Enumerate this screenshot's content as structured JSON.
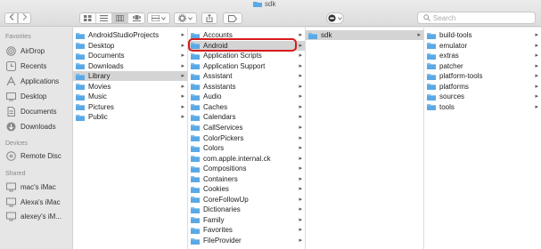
{
  "window": {
    "title": "sdk"
  },
  "toolbar": {
    "back_icon": "chevron-left",
    "forward_icon": "chevron-right",
    "view_modes": [
      "icon-view",
      "list-view",
      "column-view",
      "cover-flow-view"
    ],
    "search": {
      "placeholder": "Search",
      "value": ""
    }
  },
  "sidebar": {
    "favorites_header": "Favorites",
    "favorites": [
      {
        "label": "AirDrop",
        "icon": "airdrop-icon"
      },
      {
        "label": "Recents",
        "icon": "clock-icon"
      },
      {
        "label": "Applications",
        "icon": "applications-icon"
      },
      {
        "label": "Desktop",
        "icon": "desktop-icon"
      },
      {
        "label": "Documents",
        "icon": "documents-icon"
      },
      {
        "label": "Downloads",
        "icon": "downloads-icon"
      }
    ],
    "devices_header": "Devices",
    "devices": [
      {
        "label": "Remote Disc",
        "icon": "disc-icon"
      }
    ],
    "shared_header": "Shared",
    "shared": [
      {
        "label": "mac's iMac",
        "icon": "imac-icon"
      },
      {
        "label": "Alexa's iMac",
        "icon": "imac-icon"
      },
      {
        "label": "alexey's iM...",
        "icon": "imac-icon"
      }
    ]
  },
  "columns": {
    "home": [
      {
        "label": "AndroidStudioProjects",
        "chevron": true
      },
      {
        "label": "Desktop",
        "chevron": true
      },
      {
        "label": "Documents",
        "chevron": true
      },
      {
        "label": "Downloads",
        "chevron": true
      },
      {
        "label": "Library",
        "chevron": true,
        "selected": true
      },
      {
        "label": "Movies",
        "chevron": true
      },
      {
        "label": "Music",
        "chevron": true
      },
      {
        "label": "Pictures",
        "chevron": true
      },
      {
        "label": "Public",
        "chevron": true
      }
    ],
    "library": [
      {
        "label": "Accounts",
        "chevron": true
      },
      {
        "label": "Android",
        "chevron": true,
        "selected": true
      },
      {
        "label": "Application Scripts",
        "chevron": true
      },
      {
        "label": "Application Support",
        "chevron": true
      },
      {
        "label": "Assistant",
        "chevron": true
      },
      {
        "label": "Assistants",
        "chevron": true
      },
      {
        "label": "Audio",
        "chevron": true
      },
      {
        "label": "Caches",
        "chevron": true
      },
      {
        "label": "Calendars",
        "chevron": true
      },
      {
        "label": "CallServices",
        "chevron": true
      },
      {
        "label": "ColorPickers",
        "chevron": true
      },
      {
        "label": "Colors",
        "chevron": true
      },
      {
        "label": "com.apple.internal.ck",
        "chevron": true
      },
      {
        "label": "Compositions",
        "chevron": true
      },
      {
        "label": "Containers",
        "chevron": true
      },
      {
        "label": "Cookies",
        "chevron": true
      },
      {
        "label": "CoreFollowUp",
        "chevron": true
      },
      {
        "label": "Dictionaries",
        "chevron": true
      },
      {
        "label": "Family",
        "chevron": true
      },
      {
        "label": "Favorites",
        "chevron": true
      },
      {
        "label": "FileProvider",
        "chevron": true
      }
    ],
    "android": [
      {
        "label": "sdk",
        "chevron": true,
        "selected": true
      }
    ],
    "sdk": [
      {
        "label": "build-tools",
        "chevron": true
      },
      {
        "label": "emulator",
        "chevron": true
      },
      {
        "label": "extras",
        "chevron": true
      },
      {
        "label": "patcher",
        "chevron": true
      },
      {
        "label": "platform-tools",
        "chevron": true
      },
      {
        "label": "platforms",
        "chevron": true
      },
      {
        "label": "sources",
        "chevron": true
      },
      {
        "label": "tools",
        "chevron": true
      }
    ]
  },
  "colors": {
    "folder": "#5aa9e6",
    "highlight_ring": "#d81b1b",
    "selection": "#d4d4d4"
  }
}
